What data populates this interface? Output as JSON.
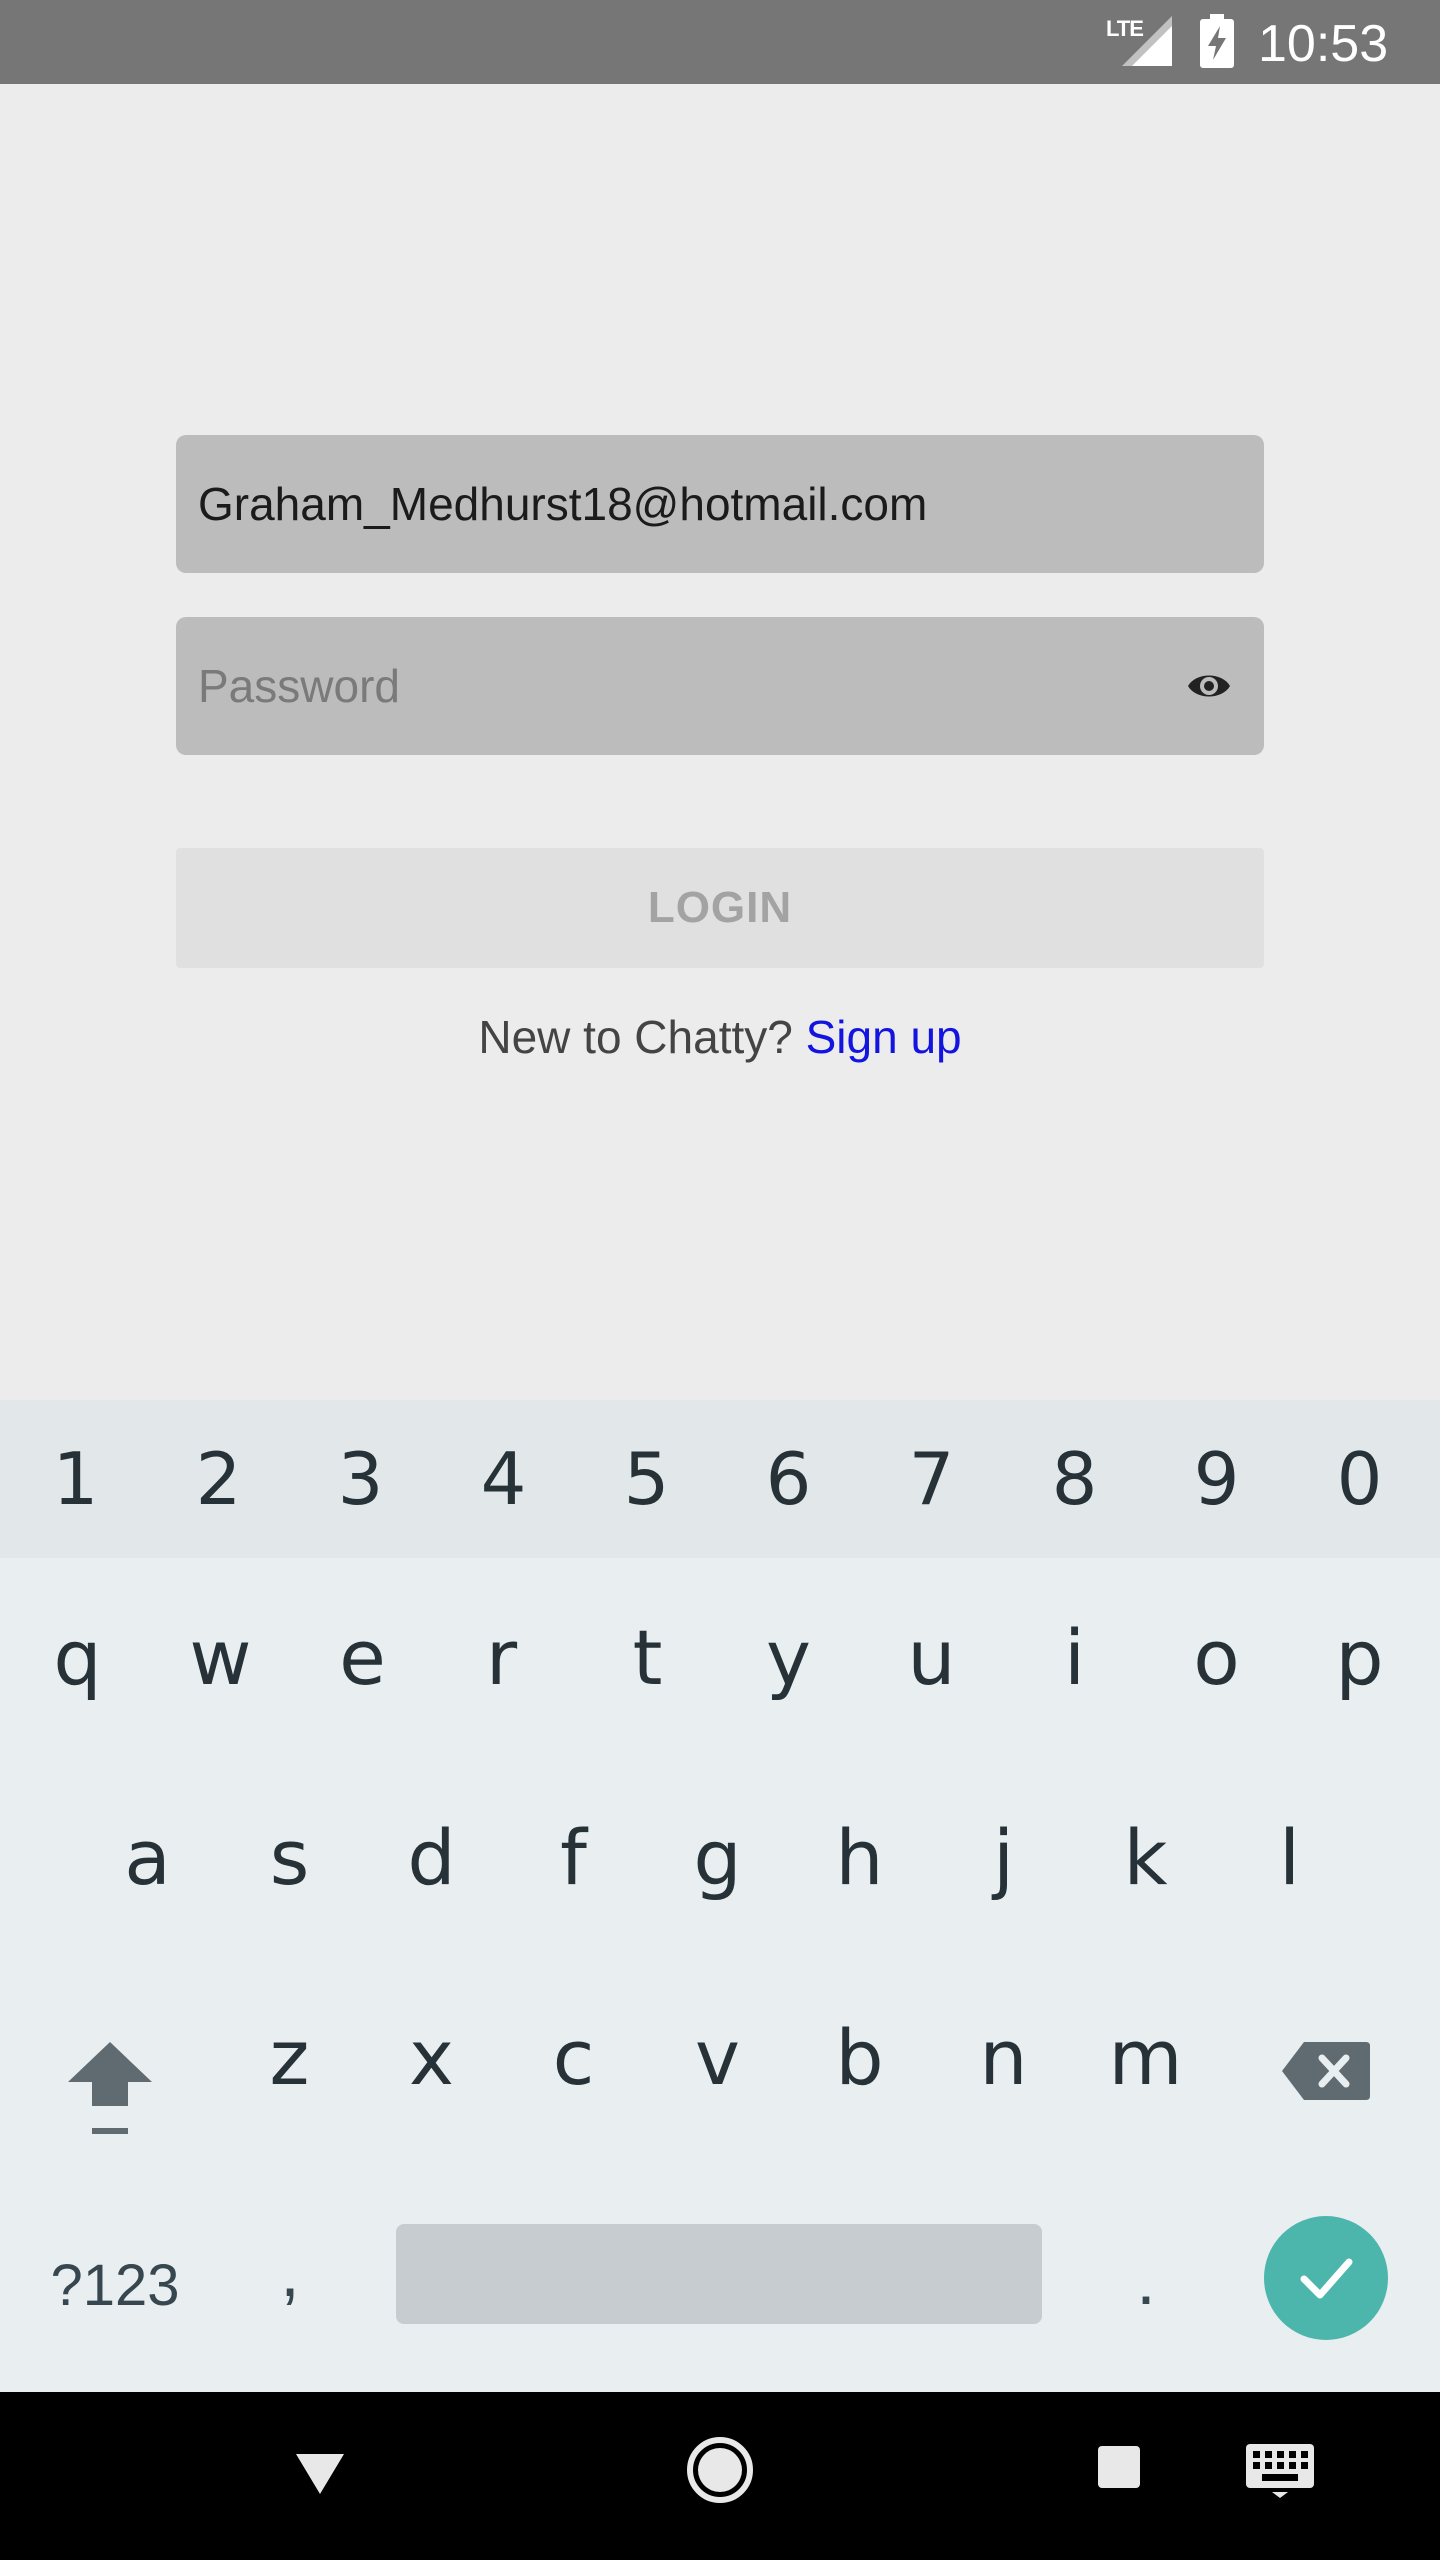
{
  "status_bar": {
    "network_label": "LTE",
    "time": "10:53",
    "icons": [
      "signal-icon",
      "battery-charging-icon"
    ]
  },
  "login_form": {
    "email_value": "Graham_Medhurst18@hotmail.com",
    "password_placeholder": "Password",
    "password_value": "",
    "visibility_icon": "eye-icon",
    "login_button_label": "LOGIN",
    "signup_prompt": "New to Chatty?",
    "signup_link": "Sign up"
  },
  "keyboard": {
    "number_row": [
      "1",
      "2",
      "3",
      "4",
      "5",
      "6",
      "7",
      "8",
      "9",
      "0"
    ],
    "row1": [
      "q",
      "w",
      "e",
      "r",
      "t",
      "y",
      "u",
      "i",
      "o",
      "p"
    ],
    "row2": [
      "a",
      "s",
      "d",
      "f",
      "g",
      "h",
      "j",
      "k",
      "l"
    ],
    "row3": [
      "z",
      "x",
      "c",
      "v",
      "b",
      "n",
      "m"
    ],
    "symbols_label": "?123",
    "comma": ",",
    "period": ".",
    "enter_icon": "check-icon",
    "accent_color": "#4db6ac"
  },
  "nav_bar": {
    "icons": [
      "back-icon",
      "home-icon",
      "recents-icon",
      "keyboard-switch-icon"
    ]
  },
  "colors": {
    "link": "#1414e0",
    "field_background": "#bcbcbc",
    "button_disabled": "#e0e0e0"
  }
}
